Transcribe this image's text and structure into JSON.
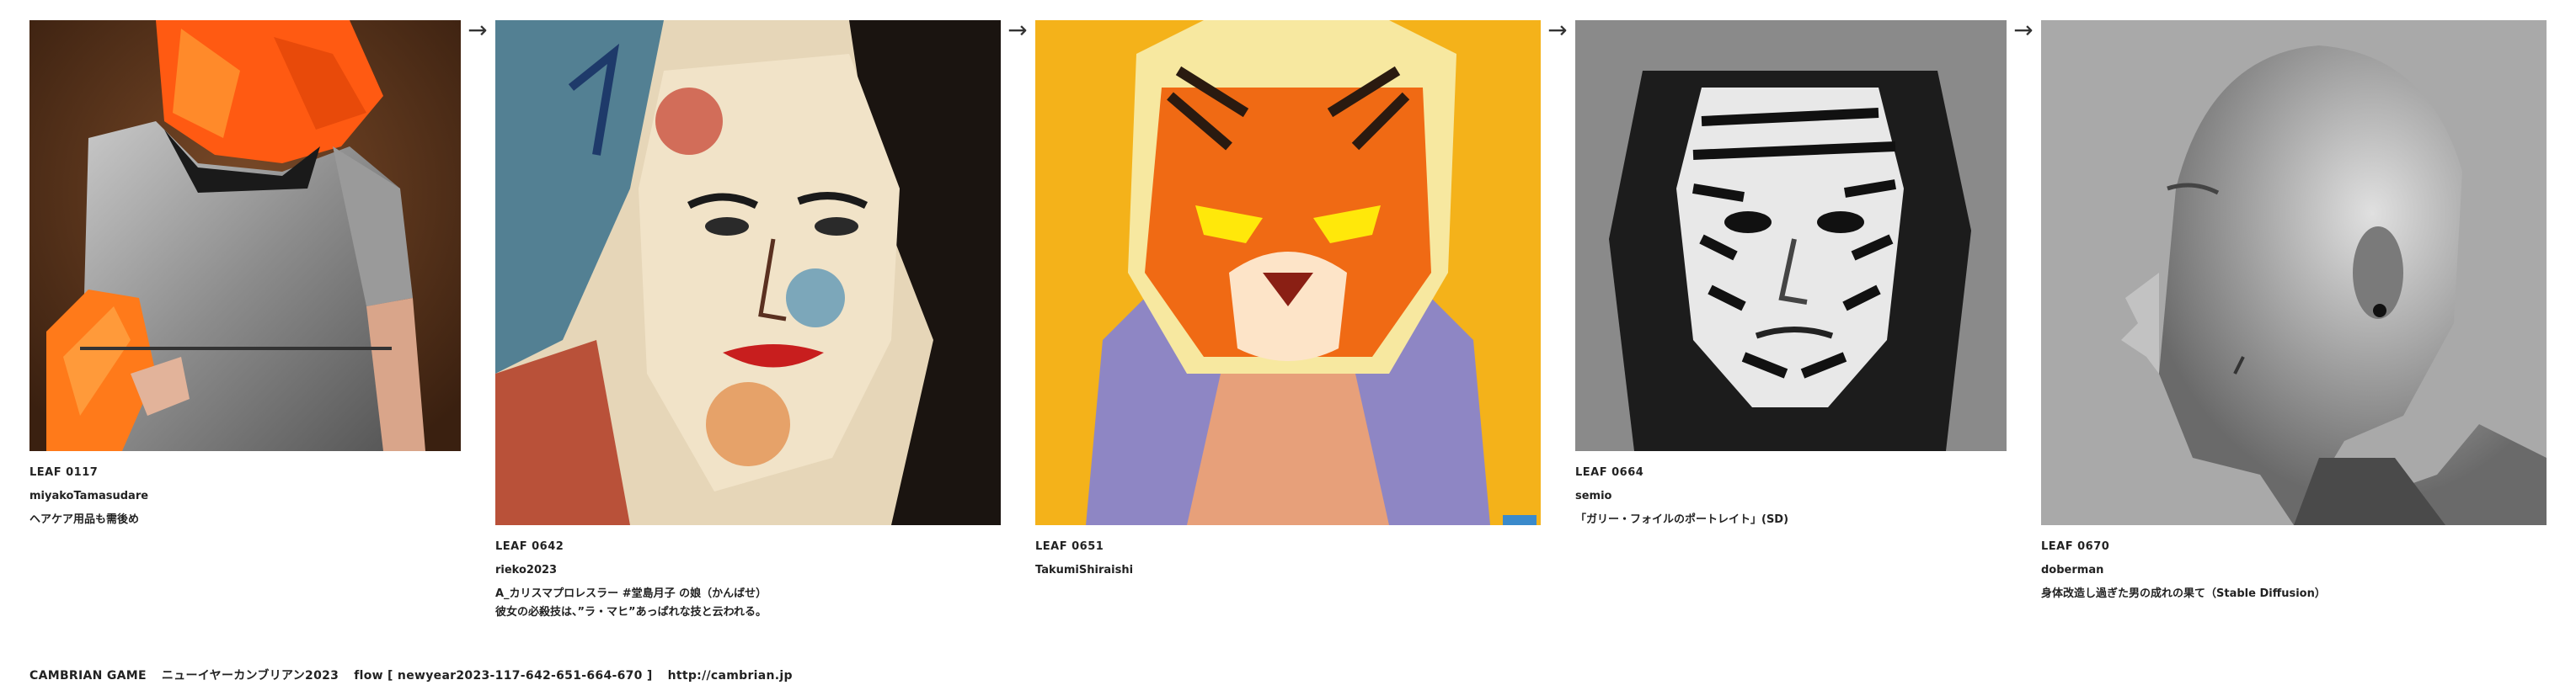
{
  "leaves": [
    {
      "id": "LEAF 0117",
      "author": "miyakoTamasudare",
      "title_lines": [
        "ヘアケア用品も需後め"
      ],
      "image": "orange-haired-knight-with-carrots"
    },
    {
      "id": "LEAF 0642",
      "author": "rieko2023",
      "title_lines": [
        "A_カリスマプロレスラー #堂島月子 の娘（かんばせ）",
        "彼女の必殺技は、”ラ・マヒ”あっぱれな技と云われる。"
      ],
      "image": "painted-woman-portrait"
    },
    {
      "id": "LEAF 0651",
      "author": "TakumiShiraishi",
      "title_lines": [],
      "image": "painted-tiger-character"
    },
    {
      "id": "LEAF 0664",
      "author": "semio",
      "title_lines": [
        "「ガリー・フォイルのポートレイト」(SD)"
      ],
      "image": "tattooed-face-portrait"
    },
    {
      "id": "LEAF 0670",
      "author": "doberman",
      "title_lines": [
        "身体改造し過ぎた男の成れの果て（Stable Diffusion）"
      ],
      "image": "bald-man-profile"
    }
  ],
  "arrow_glyph": "→",
  "footer": {
    "brand": "CAMBRIAN GAME",
    "event": "ニューイヤーカンブリアン2023",
    "flow": "flow [ newyear2023-117-642-651-664-670 ]",
    "url": "http://cambrian.jp"
  }
}
